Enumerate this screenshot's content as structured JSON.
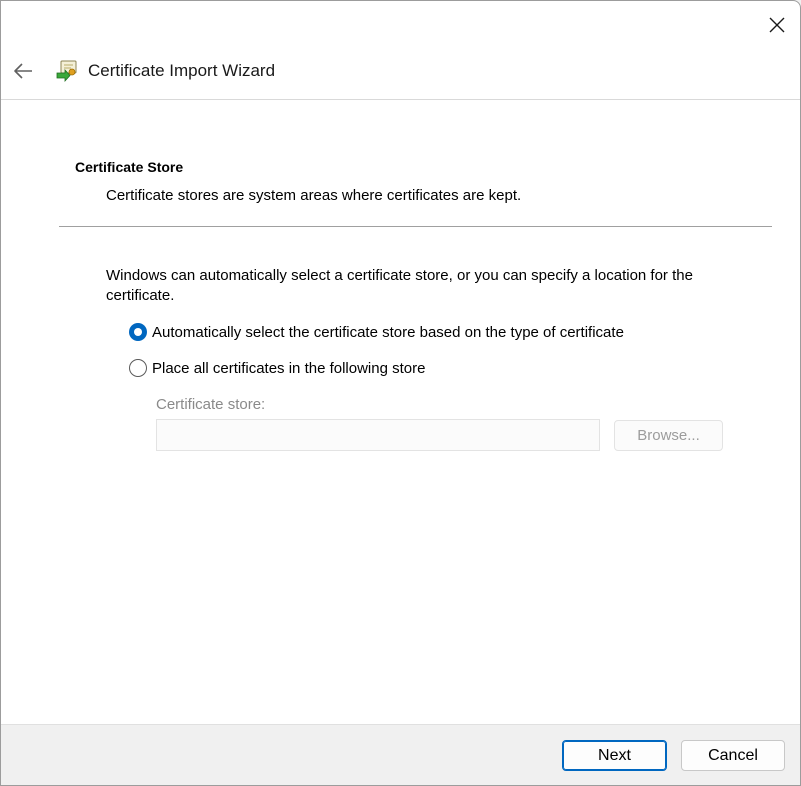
{
  "window": {
    "title": "Certificate Import Wizard",
    "icons": {
      "close": "close-icon",
      "back": "back-arrow-icon",
      "app": "certificate-import-icon"
    }
  },
  "header": {
    "section_title": "Certificate Store",
    "section_description": "Certificate stores are system areas where certificates are kept."
  },
  "body": {
    "intro": "Windows can automatically select a certificate store, or you can specify a location for the certificate.",
    "options": [
      {
        "label": "Automatically select the certificate store based on the type of certificate",
        "selected": true
      },
      {
        "label": "Place all certificates in the following store",
        "selected": false
      }
    ],
    "store_label": "Certificate store:",
    "store_value": "",
    "browse_label": "Browse..."
  },
  "footer": {
    "next_label": "Next",
    "cancel_label": "Cancel"
  },
  "colors": {
    "accent": "#0067c0",
    "disabled_text": "#9c9c9c"
  }
}
